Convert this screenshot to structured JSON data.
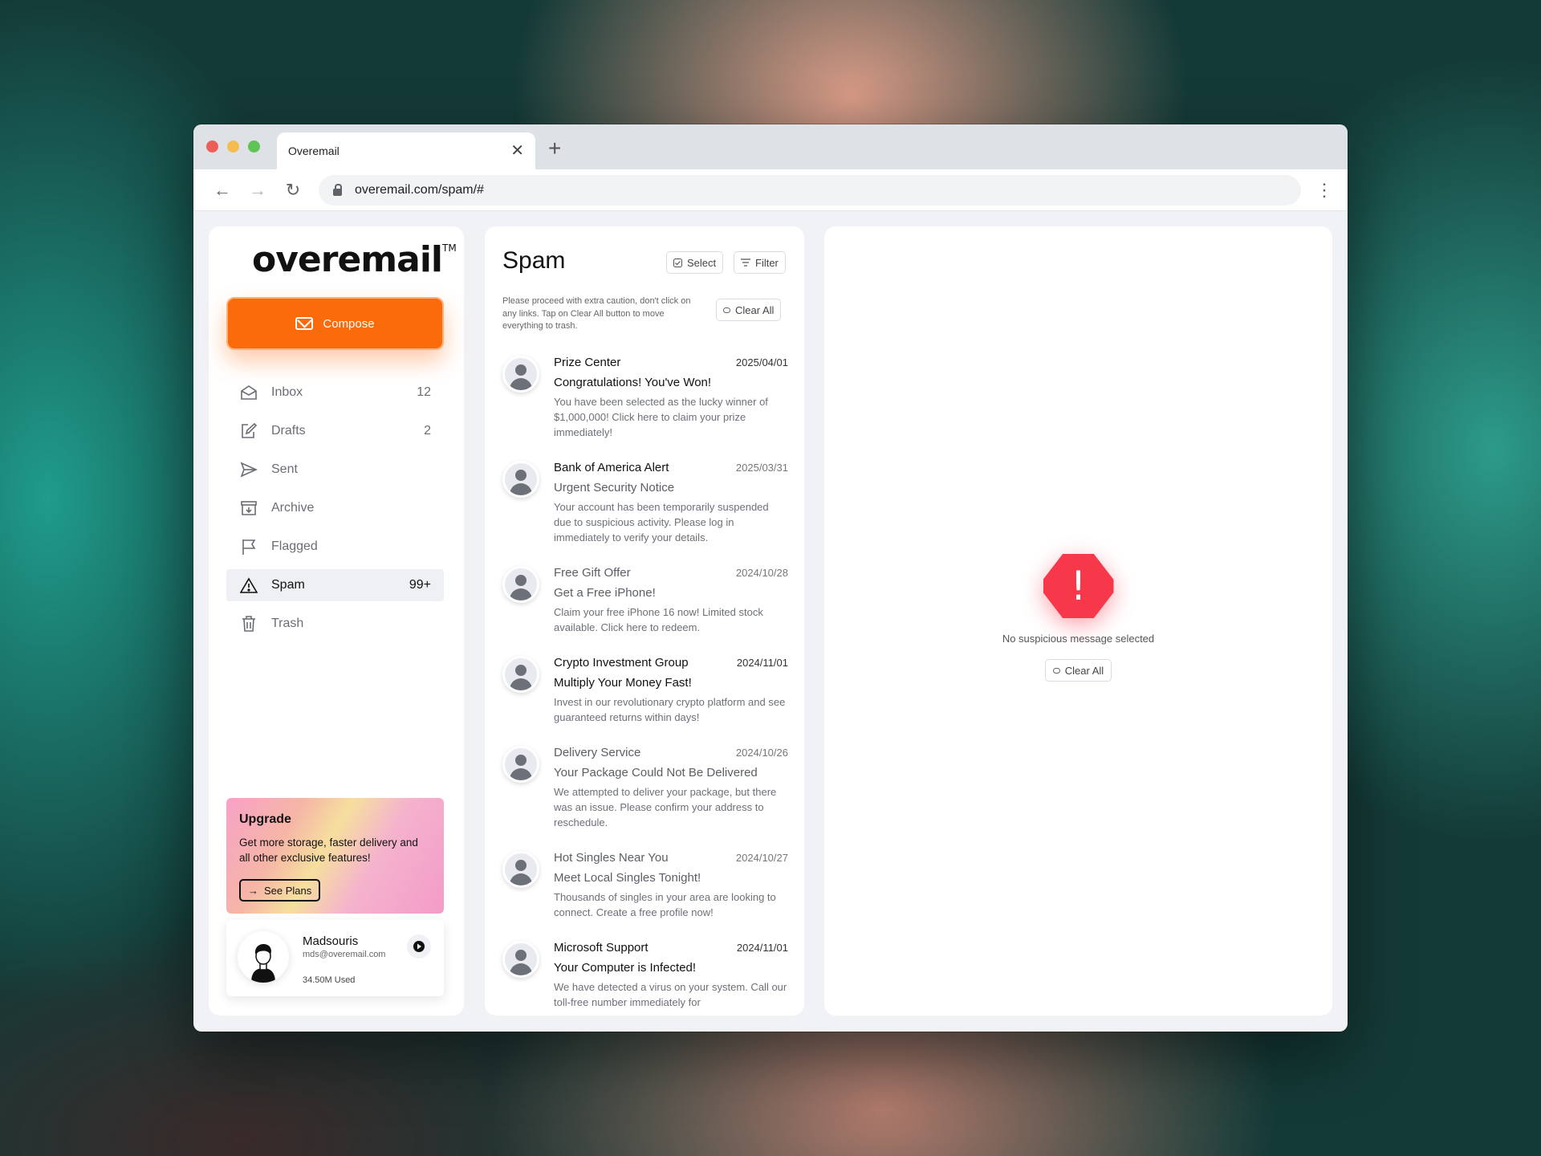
{
  "browser": {
    "tab_title": "Overemail",
    "url": "overemail.com/spam/#"
  },
  "app": {
    "logo": "overemail",
    "logo_tm": "TM",
    "compose_label": "Compose"
  },
  "nav": [
    {
      "label": "Inbox",
      "count": "12",
      "icon": "inbox-icon"
    },
    {
      "label": "Drafts",
      "count": "2",
      "icon": "drafts-icon"
    },
    {
      "label": "Sent",
      "count": "",
      "icon": "sent-icon"
    },
    {
      "label": "Archive",
      "count": "",
      "icon": "archive-icon"
    },
    {
      "label": "Flagged",
      "count": "",
      "icon": "flag-icon"
    },
    {
      "label": "Spam",
      "count": "99+",
      "icon": "warning-icon",
      "active": true
    },
    {
      "label": "Trash",
      "count": "",
      "icon": "trash-icon"
    }
  ],
  "upgrade": {
    "title": "Upgrade",
    "text": "Get more storage, faster delivery and all other exclusive features!",
    "button": "See Plans"
  },
  "profile": {
    "name": "Madsouris",
    "email": "mds@overemail.com",
    "usage": "34.50M Used"
  },
  "spam": {
    "title": "Spam",
    "select_label": "Select",
    "filter_label": "Filter",
    "clear_all_label": "Clear All",
    "warning": "Please proceed with extra caution, don't click on any links. Tap on Clear All button to move everything to trash.",
    "messages": [
      {
        "sender": "Prize Center",
        "date": "2025/04/01",
        "subject": "Congratulations! You've Won!",
        "preview": "You have been selected as the lucky winner of $1,000,000! Click here to claim your prize immediately!",
        "unread": true
      },
      {
        "sender": "Bank of America Alert",
        "date": "2025/03/31",
        "subject": "Urgent Security Notice",
        "preview": "Your account has been temporarily suspended due to suspicious activity. Please log in immediately to verify your details.",
        "unread": true
      },
      {
        "sender": "Free Gift Offer",
        "date": "2024/10/28",
        "subject": "Get a Free iPhone!",
        "preview": "Claim your free iPhone 16 now! Limited stock available. Click here to redeem.",
        "unread": false
      },
      {
        "sender": "Crypto Investment Group",
        "date": "2024/11/01",
        "subject": "Multiply Your Money Fast!",
        "preview": "Invest in our revolutionary crypto platform and see guaranteed returns within days!",
        "unread": true
      },
      {
        "sender": "Delivery Service",
        "date": "2024/10/26",
        "subject": "Your Package Could Not Be Delivered",
        "preview": "We attempted to deliver your package, but there was an issue. Please confirm your address to reschedule.",
        "unread": false
      },
      {
        "sender": "Hot Singles Near You",
        "date": "2024/10/27",
        "subject": "Meet Local Singles Tonight!",
        "preview": "Thousands of singles in your area are looking to connect. Create a free profile now!",
        "unread": false
      },
      {
        "sender": "Microsoft Support",
        "date": "2024/11/01",
        "subject": "Your Computer is Infected!",
        "preview": "We have detected a virus on your system. Call our toll-free number immediately for",
        "unread": true
      }
    ]
  },
  "detail": {
    "empty_icon": "!",
    "empty_text": "No suspicious message selected",
    "clear_all_label": "Clear All"
  },
  "colors": {
    "accent": "#fb6a0b",
    "danger": "#f6384a"
  }
}
